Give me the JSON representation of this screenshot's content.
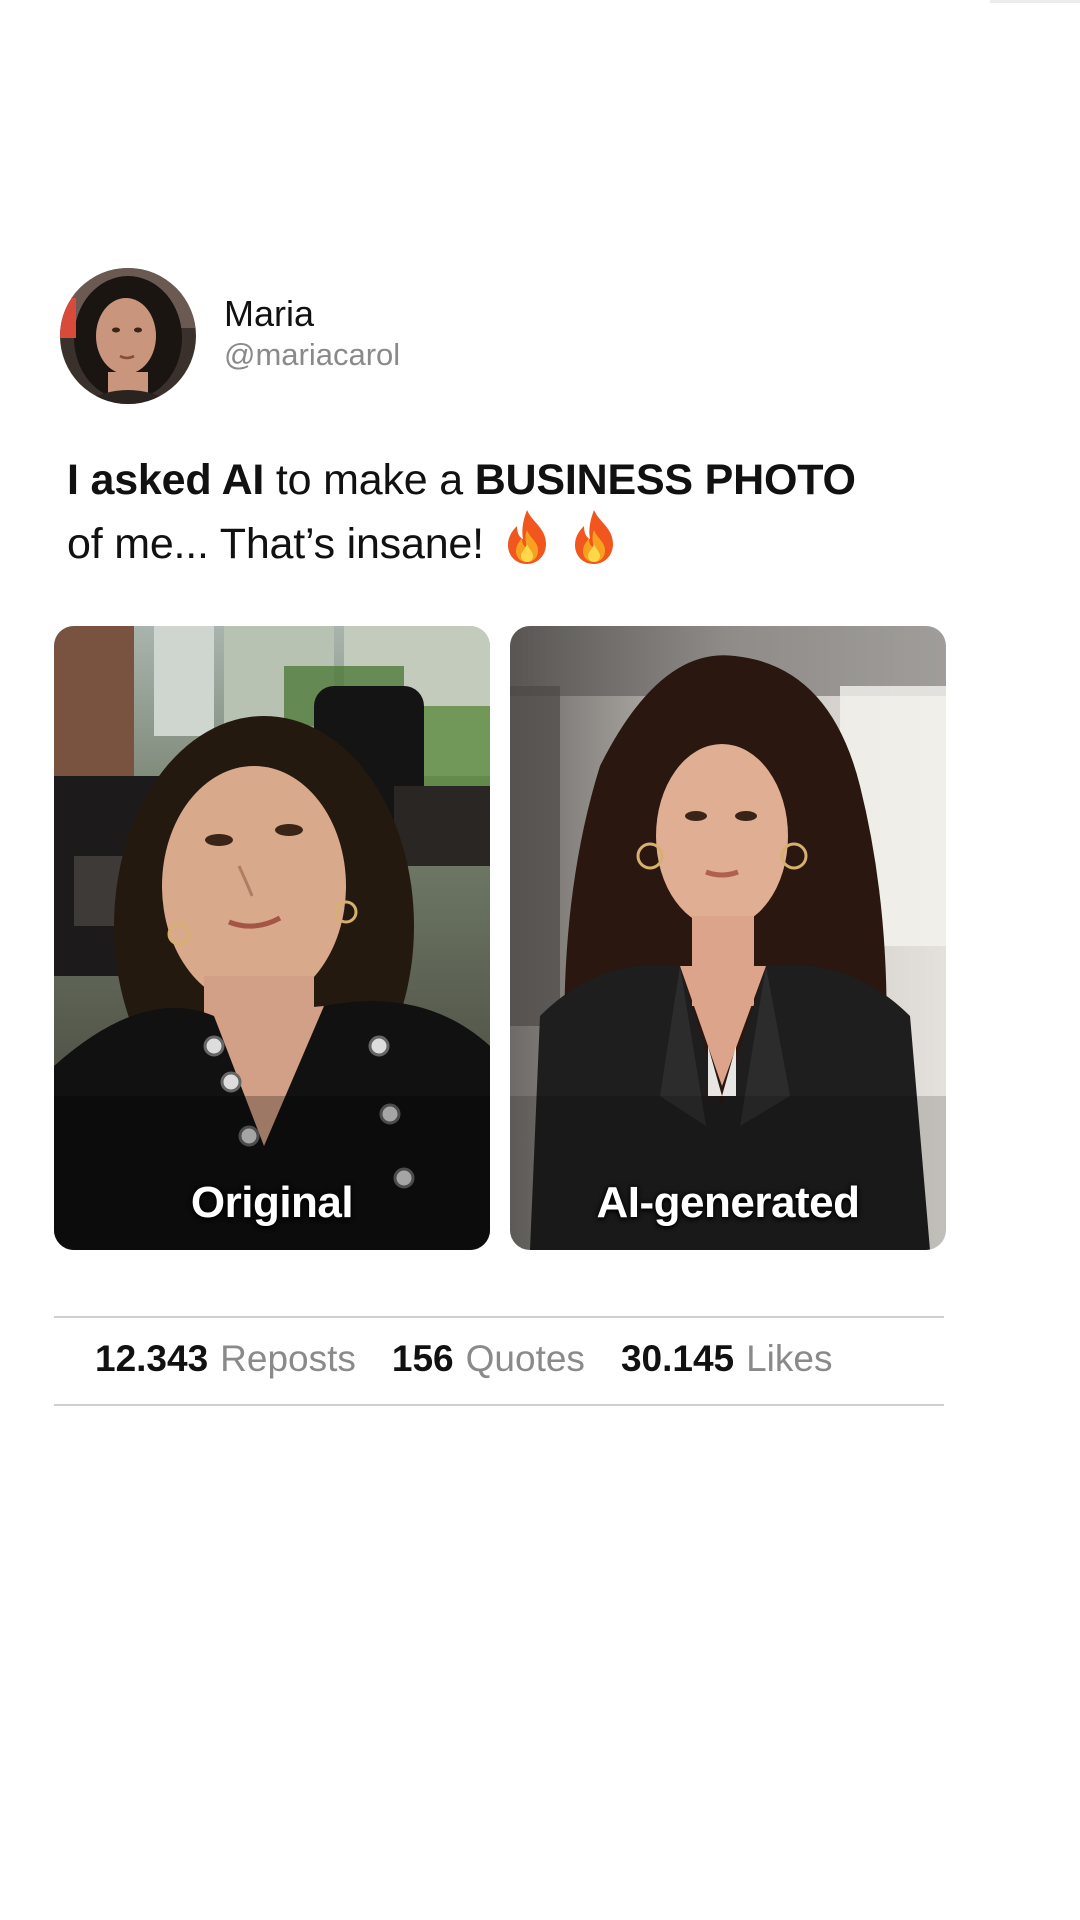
{
  "author": {
    "name": "Maria",
    "handle": "@mariacarol"
  },
  "post": {
    "text_bold_1": "I asked AI",
    "text_plain_1": " to make a ",
    "text_bold_2": "BUSINESS PHOTO",
    "text_plain_2": "of me... That’s insane!",
    "emoji_1": "🔥",
    "emoji_2": "🔥"
  },
  "photos": [
    {
      "label": "Original"
    },
    {
      "label": "AI-generated"
    }
  ],
  "stats": [
    {
      "value": "12.343",
      "label": "Reposts"
    },
    {
      "value": "156",
      "label": "Quotes"
    },
    {
      "value": "30.145",
      "label": "Likes"
    }
  ],
  "colors": {
    "background": "#ffffff",
    "text_primary": "#111111",
    "text_secondary": "#8a8a8a",
    "divider": "#cfcfcf"
  }
}
